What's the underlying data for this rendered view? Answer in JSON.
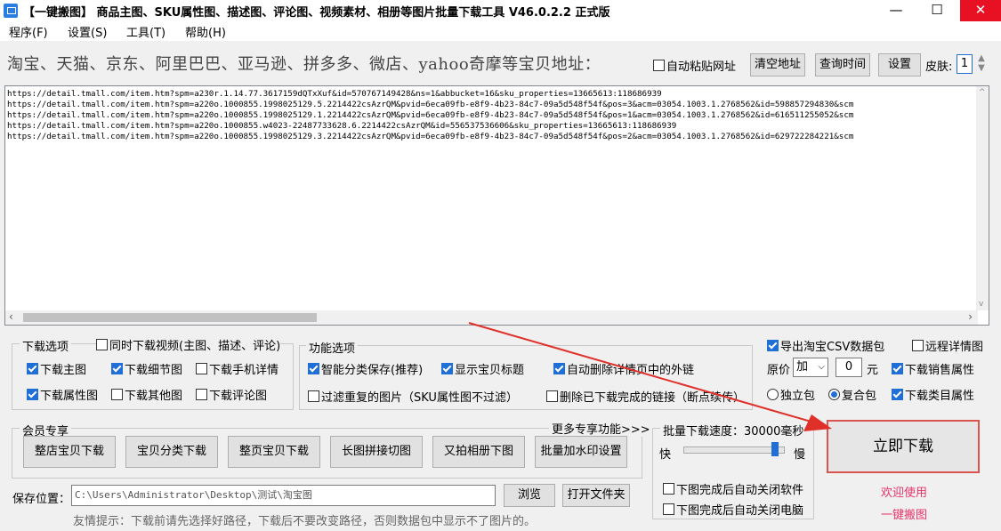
{
  "window": {
    "title": "【一键搬图】 商品主图、SKU属性图、描述图、评论图、视频素材、相册等图片批量下载工具 V46.0.2.2 正式版",
    "min_icon": "—",
    "max_icon": "☐",
    "close_icon": "✕"
  },
  "menu": [
    "程序(F)",
    "设置(S)",
    "工具(T)",
    "帮助(H)"
  ],
  "url_row": {
    "label": "淘宝、天猫、京东、阿里巴巴、亚马逊、拼多多、微店、yahoo奇摩等宝贝地址：",
    "auto_paste": "自动粘贴网址",
    "clear_btn": "清空地址",
    "query_time_btn": "查询时间",
    "settings_btn": "设置",
    "skin_label": "皮肤:",
    "skin_value": "1"
  },
  "urls": [
    "https://detail.tmall.com/item.htm?spm=a230r.1.14.77.3617159dQTxXuf&id=570767149428&ns=1&abbucket=16&sku_properties=13665613:118686939",
    "https://detail.tmall.com/item.htm?spm=a220o.1000855.1998025129.5.2214422csAzrQM&pvid=6eca09fb-e8f9-4b23-84c7-09a5d548f54f&pos=3&acm=03054.1003.1.2768562&id=598857294830&scm",
    "https://detail.tmall.com/item.htm?spm=a220o.1000855.1998025129.1.2214422csAzrQM&pvid=6eca09fb-e8f9-4b23-84c7-09a5d548f54f&pos=1&acm=03054.1003.1.2768562&id=616511255052&scm",
    "https://detail.tmall.com/item.htm?spm=a220o.1000855.w4023-22487733628.6.2214422csAzrQM&id=556537536606&sku_properties=13665613:118686939",
    "https://detail.tmall.com/item.htm?spm=a220o.1000855.1998025129.3.2214422csAzrQM&pvid=6eca09fb-e8f9-4b23-84c7-09a5d548f54f&pos=2&acm=03054.1003.1.2768562&id=629722284221&scm"
  ],
  "download_options": {
    "title": "下载选项",
    "video": "同时下载视频(主图、描述、评论)",
    "main_img": "下载主图",
    "detail_img": "下载细节图",
    "mobile_detail": "下载手机详情",
    "attr_img": "下载属性图",
    "other_img": "下载其他图",
    "review_img": "下载评论图"
  },
  "function_options": {
    "title": "功能选项",
    "smart_save": "智能分类保存(推荐)",
    "show_title": "显示宝贝标题",
    "auto_delete_links": "自动删除详情页中的外链",
    "filter_dup": "过滤重复的图片（SKU属性图不过滤）",
    "delete_done_links": "删除已下载完成的链接（断点续传）"
  },
  "csv_options": {
    "export_csv": "导出淘宝CSV数据包",
    "remote_detail": "远程详情图",
    "price_label": "原价",
    "price_op": "加",
    "price_value": "0",
    "price_unit": "元",
    "sales_attr": "下载销售属性",
    "single_pkg": "独立包",
    "combined_pkg": "复合包",
    "category_attr": "下载类目属性"
  },
  "member": {
    "title": "会员专享",
    "more": "更多专享功能>>>",
    "buttons": [
      "整店宝贝下载",
      "宝贝分类下载",
      "整页宝贝下载",
      "长图拼接切图",
      "又拍相册下图",
      "批量加水印设置"
    ]
  },
  "speed": {
    "title": "批量下载速度：30000毫秒",
    "fast": "快",
    "slow": "慢",
    "level": 0.9,
    "close_app": "下图完成后自动关闭软件",
    "shutdown": "下图完成后自动关闭电脑"
  },
  "save": {
    "label": "保存位置：",
    "path": "C:\\Users\\Administrator\\Desktop\\测试\\淘宝图",
    "browse": "浏览",
    "open_folder": "打开文件夹",
    "tip": "友情提示：下载前请先选择好路径，下载后不要改变路径，否则数据包中显示不了图片的。"
  },
  "download_btn": "立即下载",
  "welcome": [
    "欢迎使用",
    "一键搬图"
  ]
}
